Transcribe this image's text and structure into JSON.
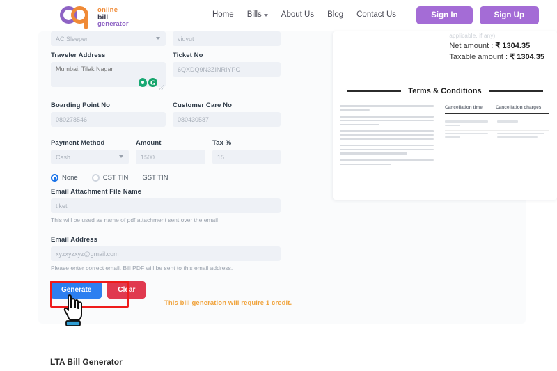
{
  "header": {
    "logo": {
      "line1": "online",
      "line2": "bill",
      "line3": "generator",
      "mark_alt": "og-logo-icon"
    },
    "nav": [
      {
        "label": "Home",
        "has_caret": false
      },
      {
        "label": "Bills",
        "has_caret": true
      },
      {
        "label": "About Us",
        "has_caret": false
      },
      {
        "label": "Blog",
        "has_caret": false
      },
      {
        "label": "Contact Us",
        "has_caret": false
      }
    ],
    "sign_in": "Sign In",
    "sign_up": "Sign Up"
  },
  "form": {
    "bus_type_value": "AC Sleeper",
    "operator_value": "vidyut",
    "traveler_address_label": "Traveler Address",
    "traveler_address_value": "Mumbai, Tilak Nagar",
    "ticket_no_label": "Ticket No",
    "ticket_no_value": "6QXDQ9N3ZINRIYPC",
    "boarding_point_label": "Boarding Point No",
    "boarding_point_value": "080278546",
    "customer_care_label": "Customer Care No",
    "customer_care_value": "080430587",
    "payment_method_label": "Payment Method",
    "payment_method_value": "Cash",
    "amount_label": "Amount",
    "amount_value": "1500",
    "tax_label": "Tax %",
    "tax_value": "15",
    "tin_options": [
      "None",
      "CST TIN",
      "GST TIN"
    ],
    "tin_selected": "None",
    "attachment_label": "Email Attachment File Name",
    "attachment_value": "tiket",
    "attachment_hint": "This will be used as name of pdf attachment sent over the email",
    "email_label": "Email Address",
    "email_value": "xyzxyzxyz@gmail.com",
    "email_hint": "Please enter correct email. Bill PDF will be sent to this email address.",
    "generate_label": "Generate",
    "clear_label": "Clear",
    "credit_note": "This bill generation will require 1 credit."
  },
  "preview": {
    "faint_line": "applicable, if any)",
    "net_amount_label": "Net amount : ",
    "net_amount_value": "₹ 1304.35",
    "taxable_amount_label": "Taxable amount : ",
    "taxable_amount_value": "₹ 1304.35",
    "terms_title": "Terms & Conditions",
    "table_headers": [
      "Cancellation time",
      "Cancellation charges"
    ]
  },
  "bottom": {
    "title": "LTA Bill Generator"
  },
  "colors": {
    "brand_purple": "#8e63c4",
    "brand_orange": "#f08a36",
    "auth_button": "#a46cd6",
    "generate_blue": "#2d7ff0",
    "clear_red": "#e0394f",
    "highlight_red": "#ef1b1b",
    "credit_orange": "#f0a33c"
  }
}
